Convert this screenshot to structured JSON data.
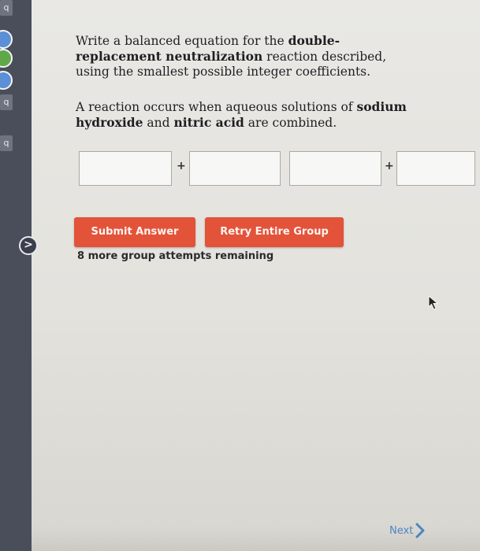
{
  "sidebar": {
    "badges": [
      "q",
      "q",
      "q"
    ],
    "next_arrow_label": ">"
  },
  "question": {
    "prompt_part1": "Write a balanced equation for the ",
    "prompt_bold1": "double-replacement neutralization",
    "prompt_part2": " reaction described, using the smallest possible integer coefficients.",
    "scenario_part1": "A reaction occurs when aqueous solutions of ",
    "scenario_bold1": "sodium hydroxide",
    "scenario_part2": " and ",
    "scenario_bold2": "nitric acid",
    "scenario_part3": " are combined."
  },
  "equation": {
    "plus_sign": "+",
    "boxes": [
      "",
      "",
      "",
      ""
    ]
  },
  "actions": {
    "submit_label": "Submit Answer",
    "retry_label": "Retry Entire Group",
    "attempts_text": "8 more group attempts remaining"
  },
  "footer": {
    "next_label": "Next"
  },
  "colors": {
    "button": "#e2533a",
    "sidebar": "#4a4e5a",
    "link": "#4c86c6"
  }
}
